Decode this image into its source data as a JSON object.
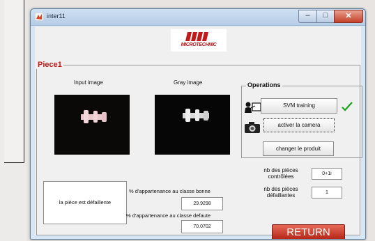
{
  "window": {
    "title": "inter11"
  },
  "logo": {
    "text": "MICROTECHNIC"
  },
  "panel": {
    "title": "Piece1"
  },
  "images": {
    "input_label": "Input image",
    "gray_label": "Gray image"
  },
  "status": {
    "message": "la pièce est défaillente"
  },
  "metrics": {
    "good_label": "% d'appartenance au classe bonne",
    "good_value": "29.9298",
    "defect_label": "% d'appartenance au classe defaute",
    "defect_value": "70.0702"
  },
  "operations": {
    "title": "Operations",
    "svm_button": "SVM training",
    "camera_button": "activer la camera",
    "change_button": "changer le produit"
  },
  "counts": {
    "controlled_label": "nb des pièces contrôlées",
    "controlled_value": "0+1i",
    "defective_label": "nb des pièces défaillantes",
    "defective_value": "1"
  },
  "return_button": "RETURN",
  "colors": {
    "accent_red": "#c81818",
    "check_green": "#19a319"
  }
}
